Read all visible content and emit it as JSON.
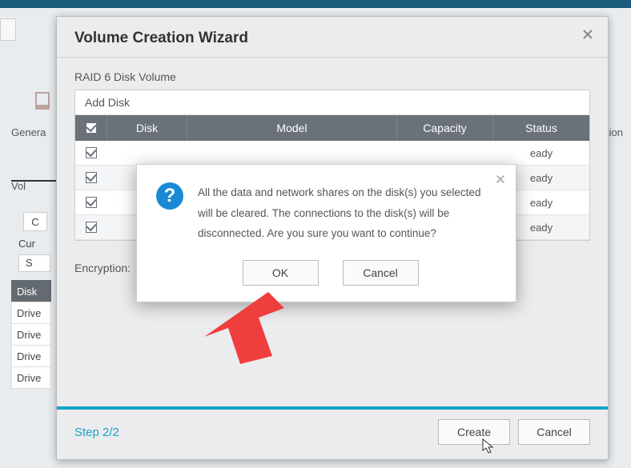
{
  "wizard": {
    "title": "Volume Creation Wizard",
    "volume_type": "RAID 6 Disk Volume",
    "add_disk_label": "Add Disk",
    "columns": {
      "disk": "Disk",
      "model": "Model",
      "capacity": "Capacity",
      "status": "Status"
    },
    "rows": [
      {
        "status": "eady"
      },
      {
        "status": "eady"
      },
      {
        "status": "eady"
      },
      {
        "status": "eady"
      }
    ],
    "encryption_label": "Encryption:",
    "step_label": "Step 2/2",
    "create_label": "Create",
    "cancel_label": "Cancel"
  },
  "confirm": {
    "message": "All the data and network shares on the disk(s) you selected will be cleared. The connections to the disk(s) will be disconnected. Are you sure you want to continue?",
    "ok_label": "OK",
    "cancel_label": "Cancel"
  },
  "background": {
    "gener_label": "Genera",
    "ation_label": "ation",
    "vol_label": "Vol",
    "c_label": "C",
    "cur_label": "Cur",
    "s_label": "S",
    "disk_label": "Disk",
    "drive_labels": [
      "Drive",
      "Drive",
      "Drive",
      "Drive"
    ]
  }
}
